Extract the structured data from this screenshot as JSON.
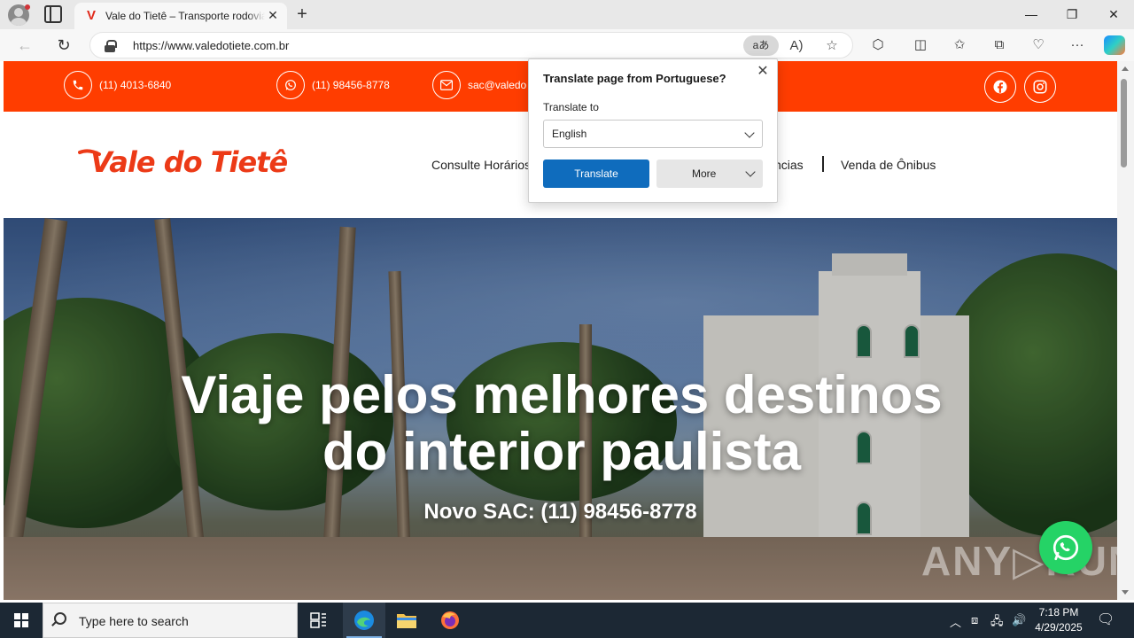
{
  "browser": {
    "tab_title": "Vale do Tietê – Transporte rodoviário",
    "url": "https://www.valedotiete.com.br",
    "translate_icon": "aあ"
  },
  "site": {
    "topbar": {
      "phone": "(11) 4013-6840",
      "whatsapp": "(11) 98456-8778",
      "email": "sac@valedo"
    },
    "logo": "Vale do Tietê",
    "nav": {
      "horarios": "Consulte Horários",
      "agencias": "ncias",
      "venda": "Venda de Ônibus"
    },
    "hero": {
      "title_line1": "Viaje pelos melhores destinos",
      "title_line2": "do interior paulista",
      "subtitle": "Novo SAC: (11) 98456-8778"
    },
    "watermark": "ANY▷RUN"
  },
  "translate_popup": {
    "title": "Translate page from Portuguese?",
    "label": "Translate to",
    "selected_language": "English",
    "translate_button": "Translate",
    "more_button": "More"
  },
  "taskbar": {
    "search_placeholder": "Type here to search",
    "time": "7:18 PM",
    "date": "4/29/2025"
  },
  "colors": {
    "brand_orange": "#ff3d00",
    "logo_red": "#ec3a17",
    "translate_blue": "#0f6cbd",
    "whatsapp_green": "#25d366"
  }
}
